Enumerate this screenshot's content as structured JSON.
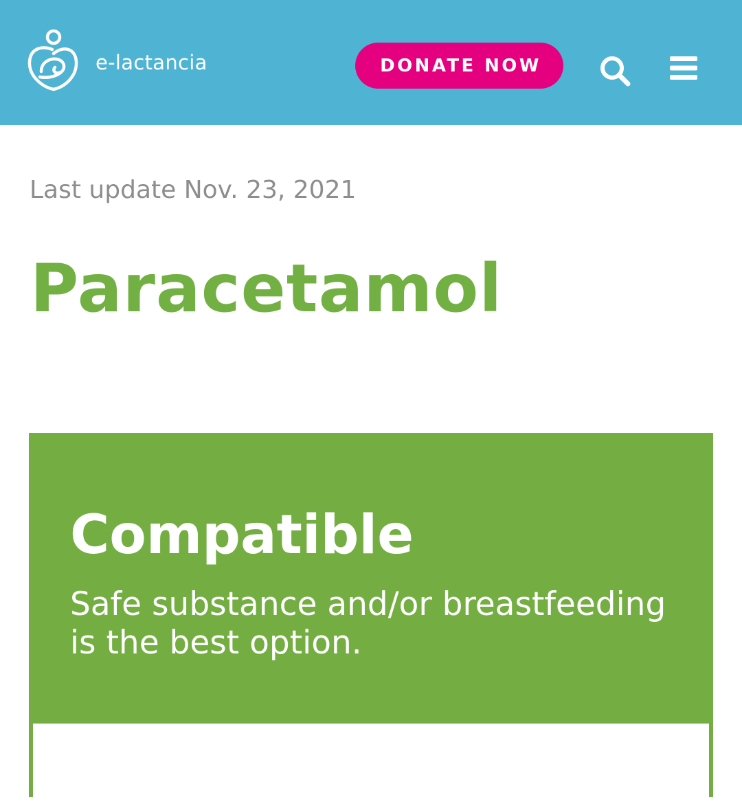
{
  "header": {
    "brand_name": "e-lactancia",
    "donate_label": "DONATE NOW",
    "icons": {
      "logo": "mother-baby-heart-logo",
      "search": "search-icon",
      "menu": "hamburger-menu-icon"
    }
  },
  "product": {
    "last_update": "Last update Nov. 23, 2021",
    "name": "Paracetamol"
  },
  "risk": {
    "level": "Compatible",
    "description": "Safe substance and/or breastfeeding is the best option."
  },
  "colors": {
    "header_bg": "#4fb3d3",
    "donate_bg": "#e4007f",
    "title_green": "#72b043",
    "card_green": "#74ae43",
    "muted_gray": "#8d8d8d"
  }
}
